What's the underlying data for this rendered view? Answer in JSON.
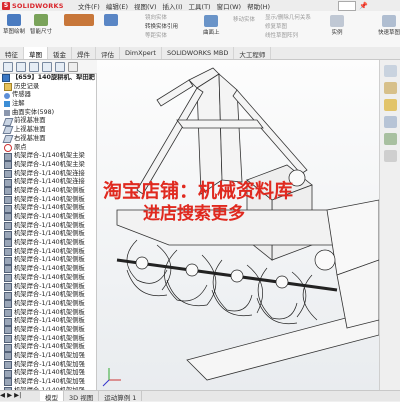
{
  "app": {
    "logo_text": "SOLIDWORKS",
    "logo_mark": "S"
  },
  "menu": [
    "文件(F)",
    "编辑(E)",
    "视图(V)",
    "插入(I)",
    "工具(T)",
    "窗口(W)",
    "帮助(H)"
  ],
  "ribbon": {
    "sketch_btn": "草图绘制",
    "smart_dim": "智能尺寸",
    "convert": "转换实体引用",
    "offset": "等距实体",
    "move": "移动实体",
    "fillet": "曲面上",
    "quick": "快速草图",
    "instant2d": "实例",
    "mirror": "镜向实体",
    "linear": "线性草图阵列",
    "display": "显示/删除几何关系",
    "repair": "修复草图"
  },
  "command_tabs": [
    "特征",
    "草图",
    "钣金",
    "焊件",
    "评估",
    "DimXpert",
    "SOLIDWORKS MBD",
    "大工程师"
  ],
  "tree": {
    "root": "【659】140旋耕机、犁田耙",
    "items": [
      {
        "label": "历史记录",
        "icon": "folder"
      },
      {
        "label": "传感器",
        "icon": "sens"
      },
      {
        "label": "注解",
        "icon": "anno"
      },
      {
        "label": "曲面实体(598)",
        "icon": "solid"
      },
      {
        "label": "前视基准面",
        "icon": "plane"
      },
      {
        "label": "上视基准面",
        "icon": "plane"
      },
      {
        "label": "右视基准面",
        "icon": "plane"
      },
      {
        "label": "原点",
        "icon": "origin"
      },
      {
        "label": "机架焊合-1/140机架主梁",
        "icon": "part"
      },
      {
        "label": "机架焊合-1/140机架主梁",
        "icon": "part"
      },
      {
        "label": "机架焊合-1/140机架连接",
        "icon": "part"
      },
      {
        "label": "机架焊合-1/140机架连接",
        "icon": "part"
      },
      {
        "label": "机架焊合-1/140机架侧板",
        "icon": "part"
      },
      {
        "label": "机架焊合-1/140机架侧板",
        "icon": "part"
      },
      {
        "label": "机架焊合-1/140机架侧板",
        "icon": "part"
      },
      {
        "label": "机架焊合-1/140机架侧板",
        "icon": "part"
      },
      {
        "label": "机架焊合-1/140机架侧板",
        "icon": "part"
      },
      {
        "label": "机架焊合-1/140机架侧板",
        "icon": "part"
      },
      {
        "label": "机架焊合-1/140机架侧板",
        "icon": "part"
      },
      {
        "label": "机架焊合-1/140机架侧板",
        "icon": "part"
      },
      {
        "label": "机架焊合-1/140机架侧板",
        "icon": "part"
      },
      {
        "label": "机架焊合-1/140机架侧板",
        "icon": "part"
      },
      {
        "label": "机架焊合-1/140机架侧板",
        "icon": "part"
      },
      {
        "label": "机架焊合-1/140机架侧板",
        "icon": "part"
      },
      {
        "label": "机架焊合-1/140机架侧板",
        "icon": "part"
      },
      {
        "label": "机架焊合-1/140机架侧板",
        "icon": "part"
      },
      {
        "label": "机架焊合-1/140机架侧板",
        "icon": "part"
      },
      {
        "label": "机架焊合-1/140机架侧板",
        "icon": "part"
      },
      {
        "label": "机架焊合-1/140机架侧板",
        "icon": "part"
      },
      {
        "label": "机架焊合-1/140机架侧板",
        "icon": "part"
      },
      {
        "label": "机架焊合-1/140机架侧板",
        "icon": "part"
      },
      {
        "label": "机架焊合-1/140机架加强",
        "icon": "part"
      },
      {
        "label": "机架焊合-1/140机架加强",
        "icon": "part"
      },
      {
        "label": "机架焊合-1/140机架加强",
        "icon": "part"
      },
      {
        "label": "机架焊合-1/140机架加强",
        "icon": "part"
      },
      {
        "label": "机架焊合-1/140机架加强",
        "icon": "part"
      }
    ]
  },
  "status_tabs": [
    "模型",
    "3D 视图",
    "运动算例 1"
  ],
  "watermark": {
    "line1": "淘宝店铺：机械资料库",
    "line2": "进店搜索更多"
  },
  "colors": {
    "brand": "#d9262c",
    "watermark": "#e0291f"
  }
}
